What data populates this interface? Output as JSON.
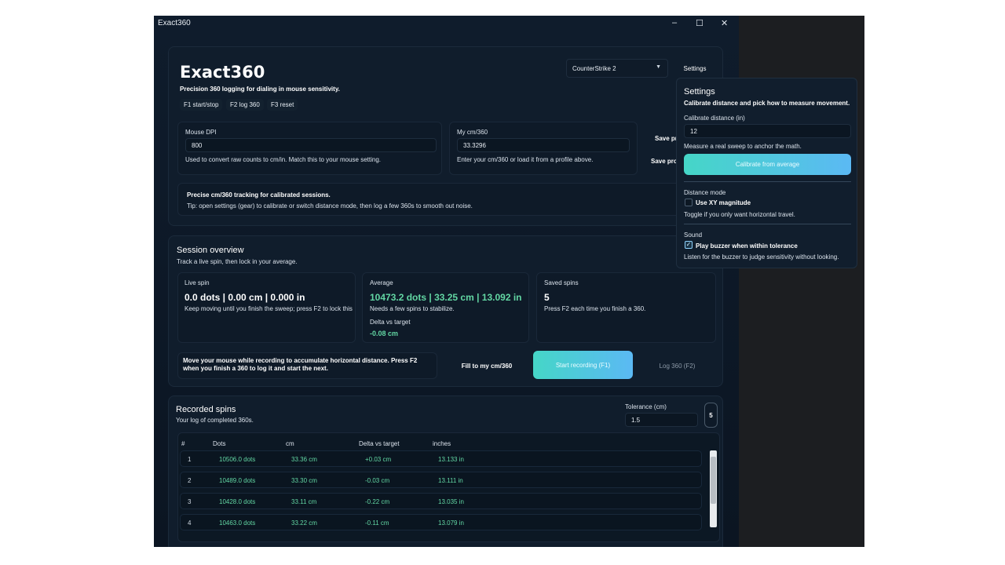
{
  "window": {
    "title": "Exact360",
    "minimize": "‒",
    "maximize": "☐",
    "close": "✕"
  },
  "header": {
    "app_title": "Exact360",
    "subtitle": "Precision 360 logging for dialing in mouse sensitivity.",
    "hotkeys": [
      "F1 start/stop",
      "F2 log 360",
      "F3 reset"
    ],
    "game_select": "CounterStrike 2",
    "settings_button": "Settings"
  },
  "dpi": {
    "label": "Mouse DPI",
    "value": "800",
    "help": "Used to convert raw counts to cm/in. Match this to your mouse setting."
  },
  "cm360": {
    "label": "My cm/360",
    "value": "33.3296",
    "help": "Enter your cm/360 or load it from a profile above."
  },
  "profile_buttons": [
    "Save pr",
    "Save pro"
  ],
  "tip": {
    "title": "Precise cm/360 tracking for calibrated sessions.",
    "body": "Tip: open settings (gear) to calibrate or switch distance mode, then log a few 360s to smooth out noise."
  },
  "session": {
    "title": "Session overview",
    "subtitle": "Track a live spin, then lock in your average.",
    "live": {
      "label": "Live spin",
      "value": "0.0 dots | 0.00 cm | 0.000 in",
      "help": "Keep moving until you finish the sweep; press F2 to lock this"
    },
    "average": {
      "label": "Average",
      "value": "10473.2 dots | 33.25 cm | 13.092 in",
      "help": "Needs a few spins to stabilize.",
      "delta_label": "Delta vs target",
      "delta_value": "-0.08 cm"
    },
    "saved": {
      "label": "Saved spins",
      "value": "5",
      "help": "Press F2 each time you finish a 360."
    },
    "instruction": "Move your mouse while recording to accumulate horizontal distance. Press F2 when you finish a 360 to log it and start the next.",
    "fill_button": "Fill to my cm/360",
    "start_button": "Start recording (F1)",
    "log_button": "Log 360 (F2)"
  },
  "recorded": {
    "title": "Recorded spins",
    "subtitle": "Your log of completed 360s.",
    "tolerance_label": "Tolerance (cm)",
    "tolerance_value": "1.5",
    "count_badge": "5",
    "columns": [
      "#",
      "Dots",
      "cm",
      "Delta vs target",
      "inches"
    ],
    "rows": [
      {
        "n": "1",
        "dots": "10506.0 dots",
        "cm": "33.36 cm",
        "delta": "+0.03 cm",
        "inches": "13.133 in"
      },
      {
        "n": "2",
        "dots": "10489.0 dots",
        "cm": "33.30 cm",
        "delta": "-0.03 cm",
        "inches": "13.111 in"
      },
      {
        "n": "3",
        "dots": "10428.0 dots",
        "cm": "33.11 cm",
        "delta": "-0.22 cm",
        "inches": "13.035 in"
      },
      {
        "n": "4",
        "dots": "10463.0 dots",
        "cm": "33.22 cm",
        "delta": "-0.11 cm",
        "inches": "13.079 in"
      }
    ]
  },
  "settings_panel": {
    "title": "Settings",
    "subtitle": "Calibrate distance and pick how to measure movement.",
    "calibrate_label": "Calibrate distance (in)",
    "calibrate_value": "12",
    "calibrate_help": "Measure a real sweep to anchor the math.",
    "calibrate_button": "Calibrate from average",
    "distance_mode_label": "Distance mode",
    "xy_label": "Use XY magnitude",
    "xy_help": "Toggle if you only want horizontal travel.",
    "sound_label": "Sound",
    "buzzer_label": "Play buzzer when within tolerance",
    "buzzer_help": "Listen for the buzzer to judge sensitivity without looking."
  },
  "colors": {
    "accent_start": "#45d6c7",
    "accent_end": "#5bb9f4",
    "green": "#62d6a3",
    "bg": "#0d1724"
  }
}
